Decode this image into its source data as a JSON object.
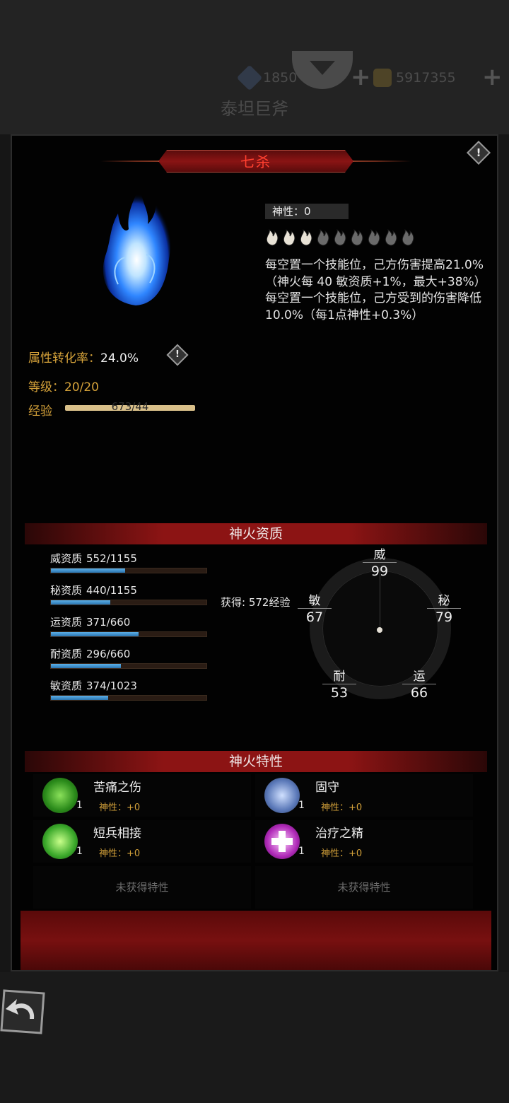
{
  "background": {
    "gem_amount": "1850",
    "gold_amount": "5917355",
    "weapon_name": "泰坦巨斧"
  },
  "panel": {
    "title": "七杀",
    "divinity": "神性：0",
    "flame_slots": {
      "filled": 3,
      "total": 9
    },
    "description_1": "每空置一个技能位，己方伤害提高21.0%（神火每 40 敏资质+1%，最大+38%）",
    "description_2": "每空置一个技能位，己方受到的伤害降低 10.0%（每1点神性+0.3%）",
    "conversion_label": "属性转化率：",
    "conversion_value": "24.0%",
    "level_label": "等级：",
    "level_value": "20/20",
    "exp_label": "经验",
    "exp_value": "673/44",
    "exp_fill": 1.0
  },
  "aptitude": {
    "header": "神火资质",
    "items": [
      {
        "label": "威资质",
        "value": "552/1155",
        "fill": 0.478
      },
      {
        "label": "秘资质",
        "value": "440/1155",
        "fill": 0.381
      },
      {
        "label": "运资质",
        "value": "371/660",
        "fill": 0.562
      },
      {
        "label": "耐资质",
        "value": "296/660",
        "fill": 0.448
      },
      {
        "label": "敏资质",
        "value": "374/1023",
        "fill": 0.366
      }
    ],
    "gain_text": "获得: 572经验",
    "radar": {
      "wei": {
        "name": "威",
        "value": "99"
      },
      "min": {
        "name": "敏",
        "value": "67"
      },
      "mi": {
        "name": "秘",
        "value": "79"
      },
      "nai": {
        "name": "耐",
        "value": "53"
      },
      "yun": {
        "name": "运",
        "value": "66"
      }
    }
  },
  "traits": {
    "header": "神火特性",
    "items": [
      {
        "name": "苦痛之伤",
        "level": "1",
        "divinity": "神性：+0",
        "icon": "pain-wound-icon",
        "color": "#3aa82a"
      },
      {
        "name": "固守",
        "level": "1",
        "divinity": "神性：+0",
        "icon": "fortify-icon",
        "color": "#5a78b8"
      },
      {
        "name": "短兵相接",
        "level": "1",
        "divinity": "神性：+0",
        "icon": "close-combat-icon",
        "color": "#3aa82a"
      },
      {
        "name": "治疗之精",
        "level": "1",
        "divinity": "神性：+0",
        "icon": "heal-essence-icon",
        "color": "#b02ab8"
      }
    ],
    "empty_label": "未获得特性"
  },
  "colors": {
    "accent_gold": "#d5a23a",
    "title_red": "#ff4030",
    "bar_blue": "#3d8fd0"
  }
}
